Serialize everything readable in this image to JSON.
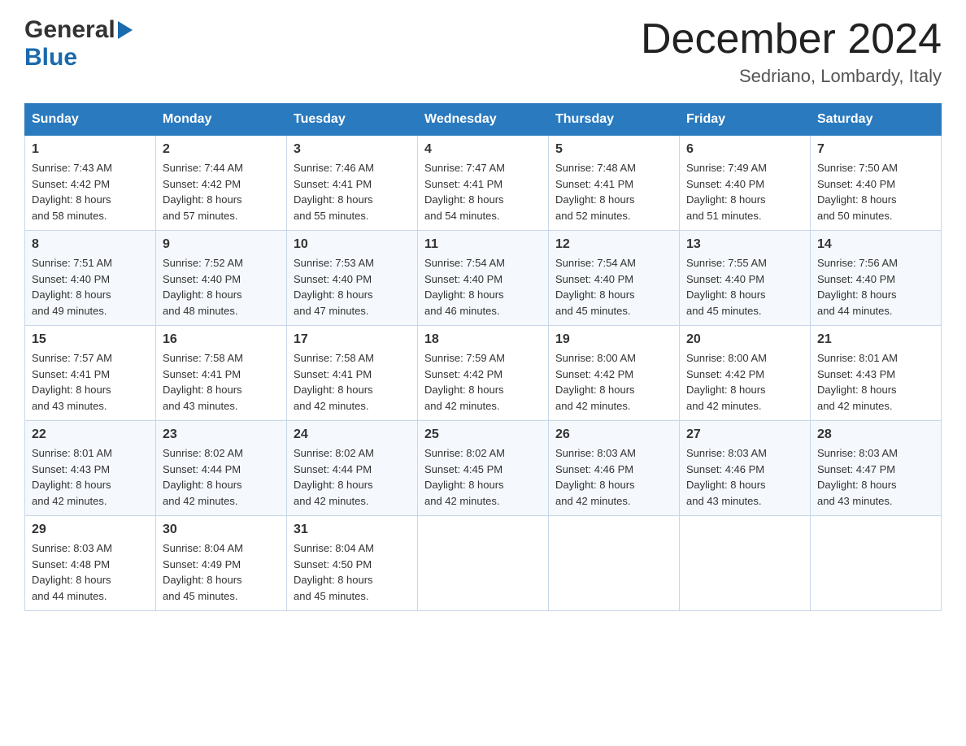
{
  "logo": {
    "general": "General",
    "blue": "Blue"
  },
  "title": "December 2024",
  "location": "Sedriano, Lombardy, Italy",
  "weekdays": [
    "Sunday",
    "Monday",
    "Tuesday",
    "Wednesday",
    "Thursday",
    "Friday",
    "Saturday"
  ],
  "weeks": [
    [
      {
        "day": "1",
        "sunrise": "7:43 AM",
        "sunset": "4:42 PM",
        "daylight": "8 hours and 58 minutes."
      },
      {
        "day": "2",
        "sunrise": "7:44 AM",
        "sunset": "4:42 PM",
        "daylight": "8 hours and 57 minutes."
      },
      {
        "day": "3",
        "sunrise": "7:46 AM",
        "sunset": "4:41 PM",
        "daylight": "8 hours and 55 minutes."
      },
      {
        "day": "4",
        "sunrise": "7:47 AM",
        "sunset": "4:41 PM",
        "daylight": "8 hours and 54 minutes."
      },
      {
        "day": "5",
        "sunrise": "7:48 AM",
        "sunset": "4:41 PM",
        "daylight": "8 hours and 52 minutes."
      },
      {
        "day": "6",
        "sunrise": "7:49 AM",
        "sunset": "4:40 PM",
        "daylight": "8 hours and 51 minutes."
      },
      {
        "day": "7",
        "sunrise": "7:50 AM",
        "sunset": "4:40 PM",
        "daylight": "8 hours and 50 minutes."
      }
    ],
    [
      {
        "day": "8",
        "sunrise": "7:51 AM",
        "sunset": "4:40 PM",
        "daylight": "8 hours and 49 minutes."
      },
      {
        "day": "9",
        "sunrise": "7:52 AM",
        "sunset": "4:40 PM",
        "daylight": "8 hours and 48 minutes."
      },
      {
        "day": "10",
        "sunrise": "7:53 AM",
        "sunset": "4:40 PM",
        "daylight": "8 hours and 47 minutes."
      },
      {
        "day": "11",
        "sunrise": "7:54 AM",
        "sunset": "4:40 PM",
        "daylight": "8 hours and 46 minutes."
      },
      {
        "day": "12",
        "sunrise": "7:54 AM",
        "sunset": "4:40 PM",
        "daylight": "8 hours and 45 minutes."
      },
      {
        "day": "13",
        "sunrise": "7:55 AM",
        "sunset": "4:40 PM",
        "daylight": "8 hours and 45 minutes."
      },
      {
        "day": "14",
        "sunrise": "7:56 AM",
        "sunset": "4:40 PM",
        "daylight": "8 hours and 44 minutes."
      }
    ],
    [
      {
        "day": "15",
        "sunrise": "7:57 AM",
        "sunset": "4:41 PM",
        "daylight": "8 hours and 43 minutes."
      },
      {
        "day": "16",
        "sunrise": "7:58 AM",
        "sunset": "4:41 PM",
        "daylight": "8 hours and 43 minutes."
      },
      {
        "day": "17",
        "sunrise": "7:58 AM",
        "sunset": "4:41 PM",
        "daylight": "8 hours and 42 minutes."
      },
      {
        "day": "18",
        "sunrise": "7:59 AM",
        "sunset": "4:42 PM",
        "daylight": "8 hours and 42 minutes."
      },
      {
        "day": "19",
        "sunrise": "8:00 AM",
        "sunset": "4:42 PM",
        "daylight": "8 hours and 42 minutes."
      },
      {
        "day": "20",
        "sunrise": "8:00 AM",
        "sunset": "4:42 PM",
        "daylight": "8 hours and 42 minutes."
      },
      {
        "day": "21",
        "sunrise": "8:01 AM",
        "sunset": "4:43 PM",
        "daylight": "8 hours and 42 minutes."
      }
    ],
    [
      {
        "day": "22",
        "sunrise": "8:01 AM",
        "sunset": "4:43 PM",
        "daylight": "8 hours and 42 minutes."
      },
      {
        "day": "23",
        "sunrise": "8:02 AM",
        "sunset": "4:44 PM",
        "daylight": "8 hours and 42 minutes."
      },
      {
        "day": "24",
        "sunrise": "8:02 AM",
        "sunset": "4:44 PM",
        "daylight": "8 hours and 42 minutes."
      },
      {
        "day": "25",
        "sunrise": "8:02 AM",
        "sunset": "4:45 PM",
        "daylight": "8 hours and 42 minutes."
      },
      {
        "day": "26",
        "sunrise": "8:03 AM",
        "sunset": "4:46 PM",
        "daylight": "8 hours and 42 minutes."
      },
      {
        "day": "27",
        "sunrise": "8:03 AM",
        "sunset": "4:46 PM",
        "daylight": "8 hours and 43 minutes."
      },
      {
        "day": "28",
        "sunrise": "8:03 AM",
        "sunset": "4:47 PM",
        "daylight": "8 hours and 43 minutes."
      }
    ],
    [
      {
        "day": "29",
        "sunrise": "8:03 AM",
        "sunset": "4:48 PM",
        "daylight": "8 hours and 44 minutes."
      },
      {
        "day": "30",
        "sunrise": "8:04 AM",
        "sunset": "4:49 PM",
        "daylight": "8 hours and 45 minutes."
      },
      {
        "day": "31",
        "sunrise": "8:04 AM",
        "sunset": "4:50 PM",
        "daylight": "8 hours and 45 minutes."
      },
      null,
      null,
      null,
      null
    ]
  ],
  "labels": {
    "sunrise": "Sunrise:",
    "sunset": "Sunset:",
    "daylight": "Daylight:"
  }
}
